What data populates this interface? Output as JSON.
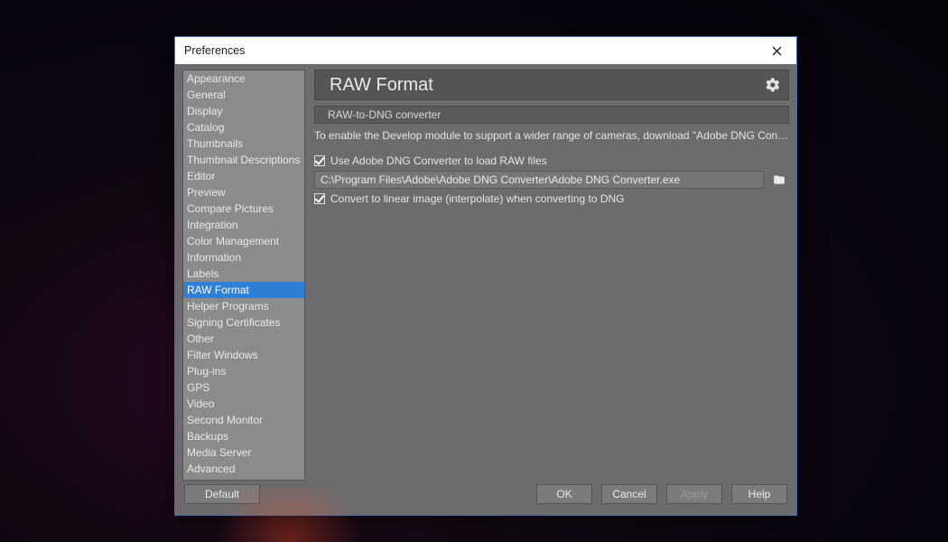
{
  "window": {
    "title": "Preferences"
  },
  "sidebar": {
    "items": [
      "Appearance",
      "General",
      "Display",
      "Catalog",
      "Thumbnails",
      "Thumbnail Descriptions",
      "Editor",
      "Preview",
      "Compare Pictures",
      "Integration",
      "Color Management",
      "Information",
      "Labels",
      "RAW Format",
      "Helper Programs",
      "Signing Certificates",
      "Other",
      "Filter Windows",
      "Plug-ins",
      "GPS",
      "Video",
      "Second Monitor",
      "Backups",
      "Media Server",
      "Advanced"
    ],
    "selected_index": 13
  },
  "pane": {
    "title": "RAW Format",
    "section_title": "RAW-to-DNG converter",
    "description": "To enable the Develop module to support a wider range of cameras, download \"Adobe DNG Convert...",
    "checkbox1_label": "Use Adobe DNG Converter to load RAW files",
    "path_value": "C:\\Program Files\\Adobe\\Adobe DNG Converter\\Adobe DNG Converter.exe",
    "checkbox2_label": "Convert to linear image (interpolate) when converting to DNG",
    "checkbox1_checked": true,
    "checkbox2_checked": true
  },
  "buttons": {
    "default": "Default",
    "ok": "OK",
    "cancel": "Cancel",
    "apply": "Apply",
    "help": "Help"
  }
}
